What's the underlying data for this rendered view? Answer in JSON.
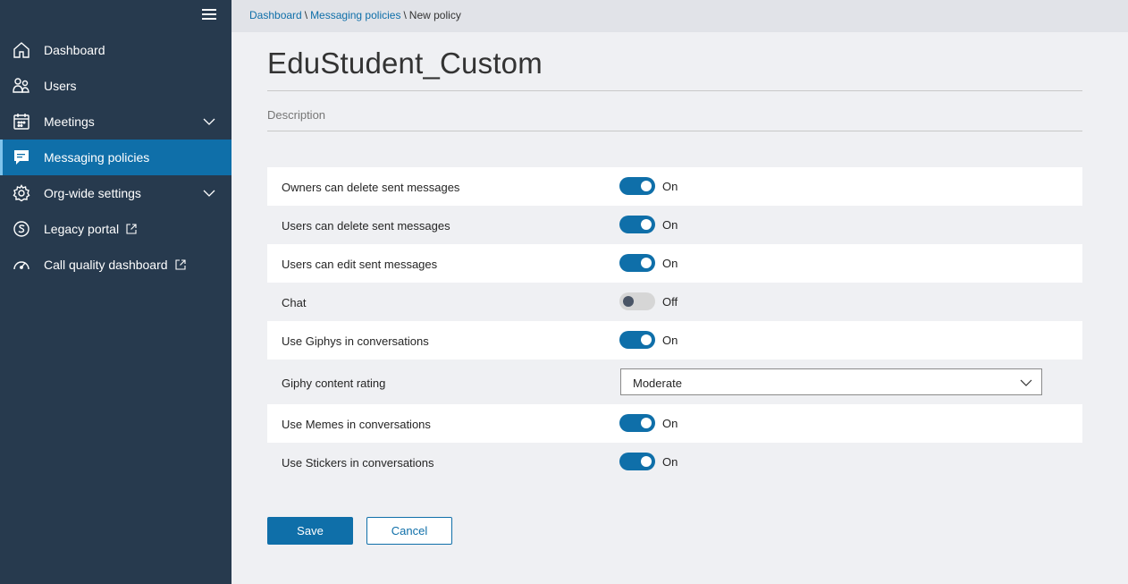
{
  "colors": {
    "sidebar_bg": "#273a4e",
    "accent": "#0f6fa9",
    "page_bg": "#eff0f3"
  },
  "sidebar": {
    "menu_icon": "hamburger-icon",
    "items": [
      {
        "label": "Dashboard",
        "icon": "home-icon",
        "active": false,
        "has_chevron": false,
        "external": false
      },
      {
        "label": "Users",
        "icon": "users-icon",
        "active": false,
        "has_chevron": false,
        "external": false
      },
      {
        "label": "Meetings",
        "icon": "calendar-icon",
        "active": false,
        "has_chevron": true,
        "external": false
      },
      {
        "label": "Messaging policies",
        "icon": "chat-icon",
        "active": true,
        "has_chevron": false,
        "external": false
      },
      {
        "label": "Org-wide settings",
        "icon": "gear-icon",
        "active": false,
        "has_chevron": true,
        "external": false
      },
      {
        "label": "Legacy portal",
        "icon": "skype-icon",
        "active": false,
        "has_chevron": false,
        "external": true
      },
      {
        "label": "Call quality dashboard",
        "icon": "gauge-icon",
        "active": false,
        "has_chevron": false,
        "external": true
      }
    ]
  },
  "breadcrumb": {
    "items": [
      "Dashboard",
      "Messaging policies",
      "New policy"
    ],
    "separator": "\\"
  },
  "policy": {
    "title": "EduStudent_Custom",
    "description_placeholder": "Description"
  },
  "settings": [
    {
      "label": "Owners can delete sent messages",
      "type": "toggle",
      "state": "On"
    },
    {
      "label": "Users can delete sent messages",
      "type": "toggle",
      "state": "On"
    },
    {
      "label": "Users can edit sent messages",
      "type": "toggle",
      "state": "On"
    },
    {
      "label": "Chat",
      "type": "toggle",
      "state": "Off"
    },
    {
      "label": "Use Giphys in conversations",
      "type": "toggle",
      "state": "On"
    },
    {
      "label": "Giphy content rating",
      "type": "select",
      "value": "Moderate"
    },
    {
      "label": "Use Memes in conversations",
      "type": "toggle",
      "state": "On"
    },
    {
      "label": "Use Stickers in conversations",
      "type": "toggle",
      "state": "On"
    }
  ],
  "actions": {
    "save_label": "Save",
    "cancel_label": "Cancel"
  }
}
